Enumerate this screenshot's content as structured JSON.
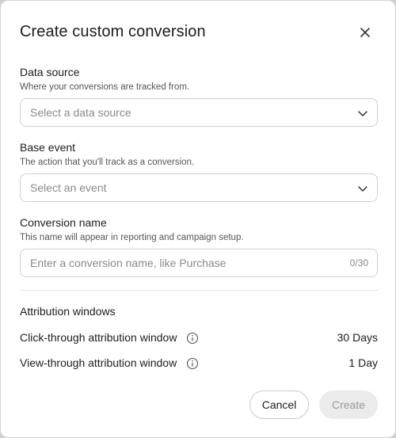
{
  "dialog": {
    "title": "Create custom conversion",
    "close_icon": "close-icon"
  },
  "fields": {
    "data_source": {
      "label": "Data source",
      "help": "Where your conversions are tracked from.",
      "placeholder": "Select a data source",
      "value": ""
    },
    "base_event": {
      "label": "Base event",
      "help": "The action that you'll track as a conversion.",
      "placeholder": "Select an event",
      "value": ""
    },
    "conversion_name": {
      "label": "Conversion name",
      "help": "This name will appear in reporting and campaign setup.",
      "placeholder": "Enter a conversion name, like Purchase",
      "value": "",
      "counter": "0/30"
    }
  },
  "attribution": {
    "title": "Attribution windows",
    "click_through": {
      "label": "Click-through attribution window",
      "value": "30 Days"
    },
    "view_through": {
      "label": "View-through attribution window",
      "value": "1 Day"
    }
  },
  "actions": {
    "cancel_label": "Cancel",
    "create_label": "Create"
  },
  "colors": {
    "text": "#1c1c1c",
    "muted": "#8a8a8a",
    "border": "#cfcfcf",
    "disabled_bg": "#ebebeb"
  }
}
